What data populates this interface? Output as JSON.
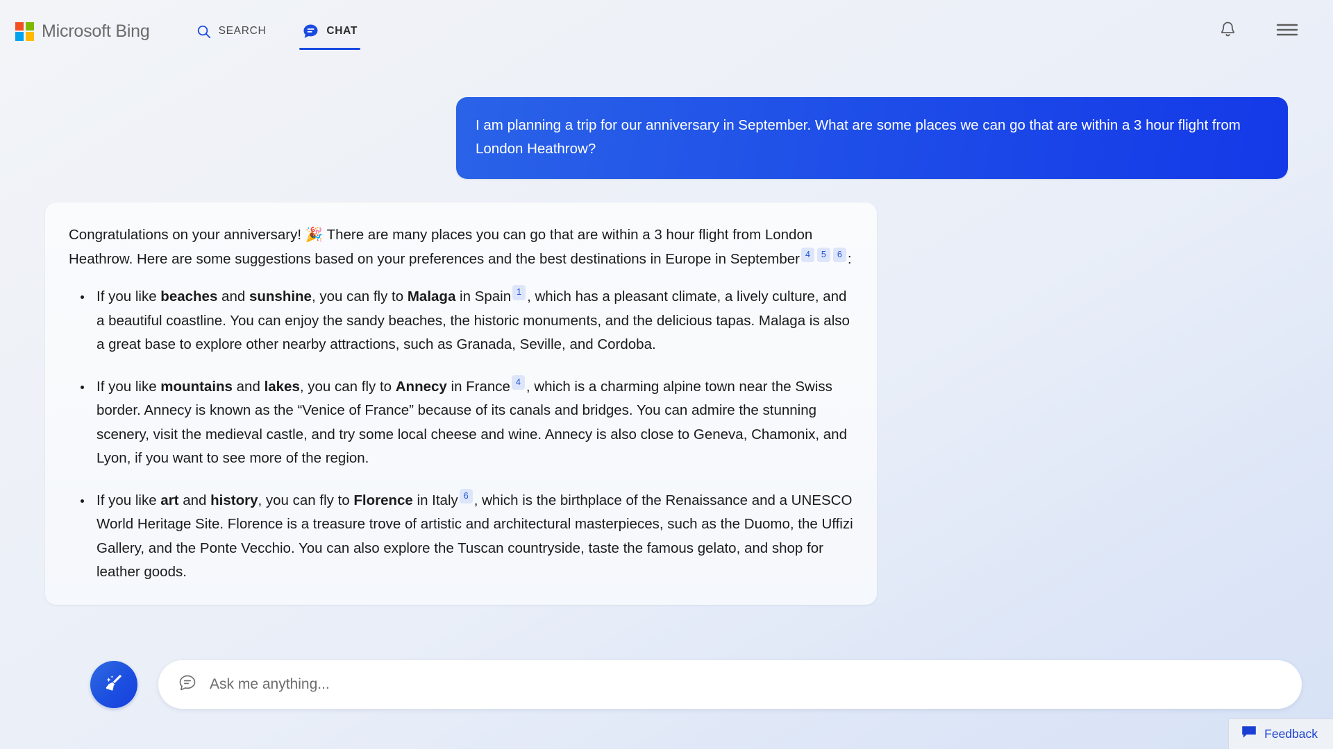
{
  "header": {
    "brand": "Microsoft Bing",
    "logo_icon": "microsoft-squares-logo",
    "nav": [
      {
        "label": "SEARCH",
        "icon": "search-icon",
        "active": false
      },
      {
        "label": "CHAT",
        "icon": "chat-bubble-icon",
        "active": true
      }
    ],
    "notifications_icon": "bell-icon",
    "menu_icon": "hamburger-menu-icon"
  },
  "conversation": {
    "user_message": "I am planning a trip for our anniversary in September. What are some places we can go that are within a 3 hour flight from London Heathrow?",
    "assistant": {
      "intro_part1": "Congratulations on your anniversary! 🎉 There are many places you can go that are within a 3 hour flight from London Heathrow. Here are some suggestions based on your preferences and the best destinations in Europe in September",
      "intro_citations": [
        "4",
        "5",
        "6"
      ],
      "intro_part2": ":",
      "bullets": [
        {
          "lead": "If you like ",
          "bold1": "beaches",
          "mid1": " and ",
          "bold2": "sunshine",
          "mid2": ", you can fly to ",
          "bold3": "Malaga",
          "mid3": " in Spain",
          "citation": "1",
          "tail": ", which has a pleasant climate, a lively culture, and a beautiful coastline. You can enjoy the sandy beaches, the historic monuments, and the delicious tapas. Malaga is also a great base to explore other nearby attractions, such as Granada, Seville, and Cordoba."
        },
        {
          "lead": "If you like ",
          "bold1": "mountains",
          "mid1": " and ",
          "bold2": "lakes",
          "mid2": ", you can fly to ",
          "bold3": "Annecy",
          "mid3": " in France",
          "citation": "4",
          "tail": ", which is a charming alpine town near the Swiss border. Annecy is known as the “Venice of France” because of its canals and bridges. You can admire the stunning scenery, visit the medieval castle, and try some local cheese and wine. Annecy is also close to Geneva, Chamonix, and Lyon, if you want to see more of the region."
        },
        {
          "lead": "If you like ",
          "bold1": "art",
          "mid1": " and ",
          "bold2": "history",
          "mid2": ", you can fly to ",
          "bold3": "Florence",
          "mid3": " in Italy",
          "citation": "6",
          "tail": ", which is the birthplace of the Renaissance and a UNESCO World Heritage Site. Florence is a treasure trove of artistic and architectural masterpieces, such as the Duomo, the Uffizi Gallery, and the Ponte Vecchio. You can also explore the Tuscan countryside, taste the famous gelato, and shop for leather goods."
        }
      ]
    }
  },
  "composer": {
    "new_topic_icon": "broom-icon",
    "input_icon": "chat-bubble-outline-icon",
    "placeholder": "Ask me anything...",
    "value": ""
  },
  "feedback": {
    "label": "Feedback",
    "icon": "feedback-speech-icon"
  },
  "colors": {
    "accent_blue": "#1a4ae0",
    "user_bubble_blue": "#1f4fe8",
    "citation_bg": "#dde5fb",
    "citation_text": "#2155d4",
    "feedback_text": "#1a3fd4"
  }
}
